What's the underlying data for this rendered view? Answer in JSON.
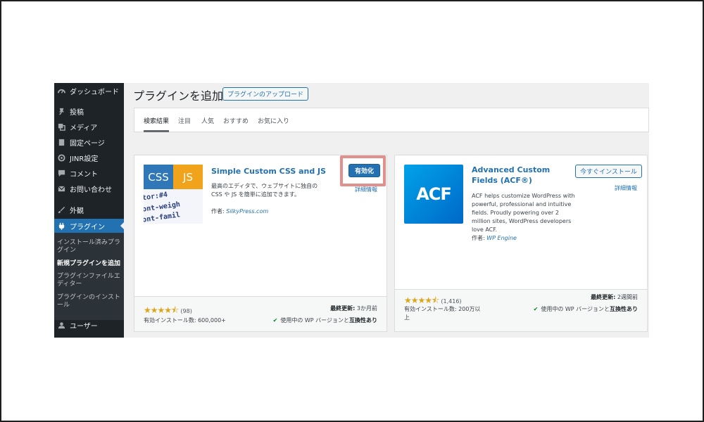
{
  "sidebar": {
    "items": [
      {
        "label": "ダッシュボード",
        "icon": "dashboard-icon"
      },
      {
        "label": "投稿",
        "icon": "pin-icon"
      },
      {
        "label": "メディア",
        "icon": "media-icon"
      },
      {
        "label": "固定ページ",
        "icon": "page-icon"
      },
      {
        "label": "JINR設定",
        "icon": "settings-icon"
      },
      {
        "label": "コメント",
        "icon": "comment-icon"
      },
      {
        "label": "お問い合わせ",
        "icon": "mail-icon"
      },
      {
        "label": "外観",
        "icon": "brush-icon"
      },
      {
        "label": "プラグイン",
        "icon": "plugin-icon"
      },
      {
        "label": "ユーザー",
        "icon": "user-icon"
      }
    ],
    "submenu": [
      {
        "label": "インストール済みプラグイン"
      },
      {
        "label": "新規プラグインを追加"
      },
      {
        "label": "プラグインファイルエディター"
      },
      {
        "label": "プラグインのインストール"
      }
    ]
  },
  "header": {
    "title": "プラグインを追加",
    "upload_button": "プラグインのアップロード"
  },
  "filter_tabs": [
    "検索結果",
    "注目",
    "人気",
    "おすすめ",
    "お気に入り"
  ],
  "cards": [
    {
      "name": "Simple Custom CSS and JS",
      "action_button": "有効化",
      "details_link": "詳細情報",
      "description": "最高のエディタで、ウェブサイトに独自の CSS や JS を簡単に追加できます。",
      "author_label": "作者:",
      "author": "SilkyPress.com",
      "thumbnail": {
        "css": "CSS",
        "js": "JS",
        "code_lines": [
          "tor:#4",
          "ont-weigh",
          "ont-famil"
        ]
      },
      "rating": 4.5,
      "rating_count": "(98)",
      "last_updated_label": "最終更新:",
      "last_updated": "3か月前",
      "installs": "有効インストール数: 600,000+",
      "compat_prefix": "使用中の WP バージョンと",
      "compat_strong": "互換性あり"
    },
    {
      "name": "Advanced Custom Fields (ACF®)",
      "action_button": "今すぐインストール",
      "details_link": "詳細情報",
      "description": "ACF helps customize WordPress with powerful, professional and intuitive fields. Proudly powering over 2 million sites, WordPress developers love ACF.",
      "author_label": "作者:",
      "author": "WP Engine",
      "thumbnail": {
        "logo": "ACF"
      },
      "rating": 4.5,
      "rating_count": "(1,416)",
      "last_updated_label": "最終更新:",
      "last_updated": "2週間前",
      "installs": "有効インストール数: 200万以上",
      "compat_prefix": "使用中の WP バージョンと",
      "compat_strong": "互換性あり"
    }
  ],
  "colors": {
    "admin_bar": "#1d2327",
    "accent": "#2271b1",
    "highlight": "#e1908d",
    "star": "#dba617"
  }
}
